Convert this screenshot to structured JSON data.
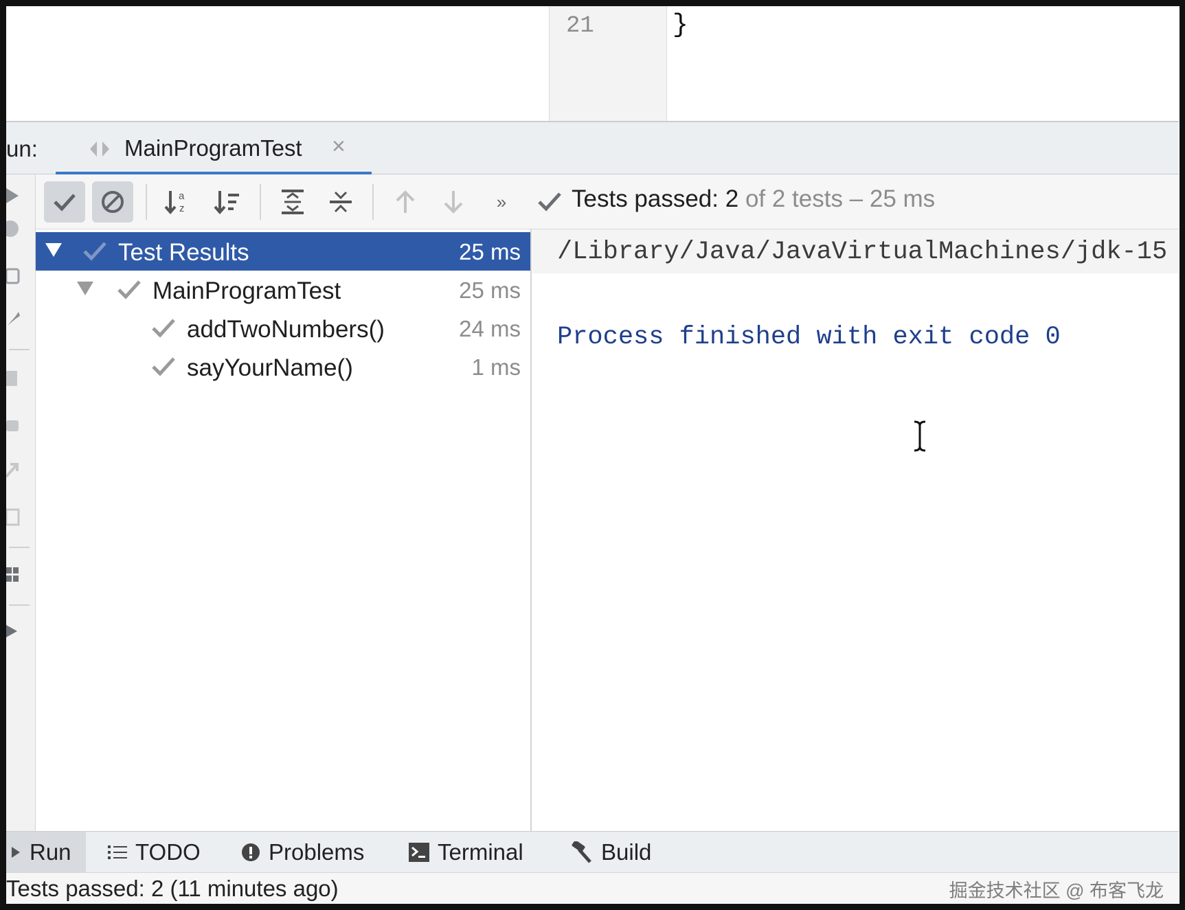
{
  "editor": {
    "line_number": "21",
    "code_line": "}"
  },
  "run_panel": {
    "label": "un:",
    "tab": {
      "title": "MainProgramTest",
      "close": "×"
    }
  },
  "toolbar": {
    "buttons": [
      "show-passed-icon",
      "show-ignored-icon",
      "sort-alphabetically-icon",
      "sort-by-duration-icon",
      "expand-all-icon",
      "collapse-all-icon",
      "previous-failed-icon",
      "next-failed-icon",
      "more-icon"
    ],
    "more": "»",
    "status_passed": "Tests passed: 2",
    "status_rest": "of 2 tests – 25 ms"
  },
  "tree": {
    "rows": [
      {
        "name": "Test Results",
        "duration": "25 ms",
        "selected": true
      },
      {
        "name": "MainProgramTest",
        "duration": "25 ms"
      },
      {
        "name": "addTwoNumbers()",
        "duration": "24 ms"
      },
      {
        "name": "sayYourName()",
        "duration": "1 ms"
      }
    ]
  },
  "console": {
    "line1": "/Library/Java/JavaVirtualMachines/jdk-15",
    "line2": "Process finished with exit code 0"
  },
  "bottom_tabs": [
    {
      "label": "Run",
      "icon": "run-icon",
      "active": true
    },
    {
      "label": "TODO",
      "icon": "list-icon"
    },
    {
      "label": "Problems",
      "icon": "problems-icon"
    },
    {
      "label": "Terminal",
      "icon": "terminal-icon"
    },
    {
      "label": "Build",
      "icon": "hammer-icon"
    }
  ],
  "status_bar": {
    "text": "Tests passed: 2 (11 minutes ago)",
    "watermark": "掘金技术社区 @ 布客飞龙"
  },
  "colors": {
    "selection": "#2f5aa8",
    "tab_underline": "#3d78c8",
    "console_text": "#1f3f8c",
    "check": "#9a9a9a"
  }
}
